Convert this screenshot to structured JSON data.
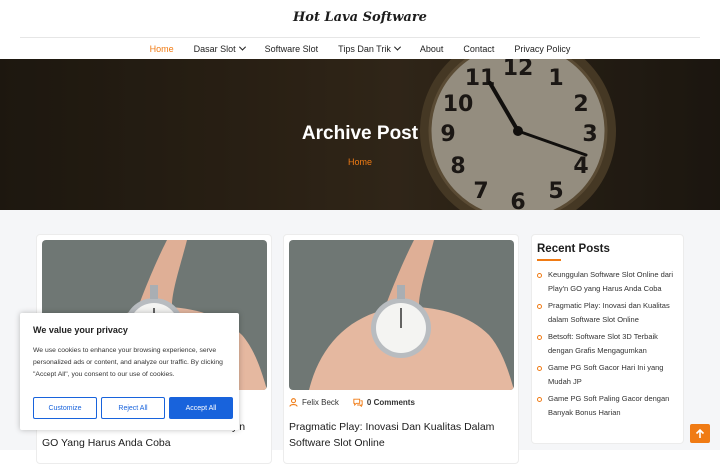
{
  "site": {
    "title": "Hot Lava Software"
  },
  "nav": {
    "items": [
      {
        "label": "Home",
        "active": true,
        "dropdown": false
      },
      {
        "label": "Dasar Slot",
        "active": false,
        "dropdown": true
      },
      {
        "label": "Software Slot",
        "active": false,
        "dropdown": false
      },
      {
        "label": "Tips Dan Trik",
        "active": false,
        "dropdown": true
      },
      {
        "label": "About",
        "active": false,
        "dropdown": false
      },
      {
        "label": "Contact",
        "active": false,
        "dropdown": false
      },
      {
        "label": "Privacy Policy",
        "active": false,
        "dropdown": false
      }
    ]
  },
  "hero": {
    "title": "Archive Post",
    "breadcrumb": "Home"
  },
  "posts": [
    {
      "author": "",
      "comments": "",
      "title": "GO Yang Harus Anda Coba",
      "title_partial": "y'n"
    },
    {
      "author": "Felix Beck",
      "comments": "0 Comments",
      "title": "Pragmatic Play: Inovasi Dan Kualitas Dalam Software Slot Online"
    }
  ],
  "sidebar": {
    "title": "Recent Posts",
    "items": [
      "Keunggulan Software Slot Online dari Play'n GO yang Harus Anda Coba",
      "Pragmatic Play: Inovasi dan Kualitas dalam Software Slot Online",
      "Betsoft: Software Slot 3D Terbaik dengan Grafis Mengagumkan",
      "Game PG Soft Gacor Hari Ini yang Mudah JP",
      "Game PG Soft Paling Gacor dengan Banyak Bonus Harian"
    ]
  },
  "cookie": {
    "title": "We value your privacy",
    "text": "We use cookies to enhance your browsing experience, serve personalized ads or content, and analyze our traffic. By clicking \"Accept All\", you consent to our use of cookies.",
    "customize": "Customize",
    "reject": "Reject All",
    "accept": "Accept All"
  },
  "colors": {
    "accent": "#f07b14",
    "cookie_blue": "#1863dc"
  }
}
